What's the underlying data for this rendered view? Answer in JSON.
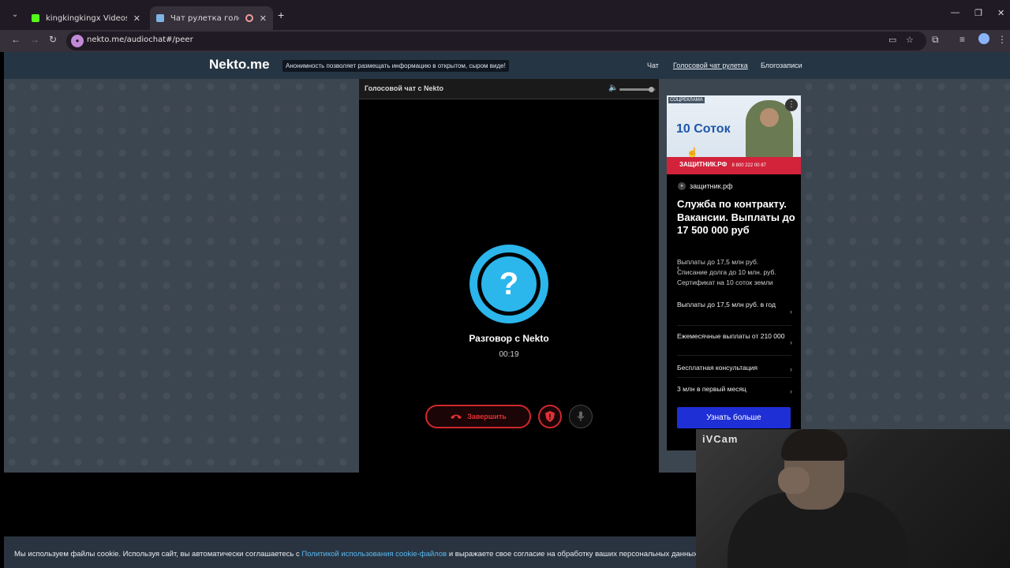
{
  "browser": {
    "tabs": [
      {
        "title": "kingkingkingx Videos - Watch Clips",
        "favicon_color": "#53fc18"
      },
      {
        "title": "Чат рулетка голосовая — Nekto.me",
        "favicon_color": "#7fb2e5"
      }
    ],
    "url": "nekto.me/audiochat#/peer"
  },
  "site": {
    "logo": "Nekto.me",
    "tagline": "Анонимность позволяет размещать информацию в открытом, сыром виде!",
    "nav": [
      {
        "label": "Чат"
      },
      {
        "label": "Голосовой чат рулетка"
      },
      {
        "label": "Блогозаписи"
      }
    ]
  },
  "chat": {
    "title": "Голосовой чат с Nekto",
    "volume": 0.9,
    "avatar_glyph": "?",
    "peer_name": "Разговор с Nekto",
    "timer": "00:19",
    "end_label": "Завершить",
    "accent": "#2bb6ec",
    "danger": "#d0282c"
  },
  "ad": {
    "label": "СОЦРЕКЛАМА",
    "banner_headline": "10 Соток",
    "banner_strip": "ЗАЩИТНИК.РФ",
    "banner_phone": "8 800 222 00 87",
    "site": "защитник.рф",
    "title": "Служба по контракту. Вакансии. Выплаты до 17 500 000 руб",
    "desc_lines": [
      "Выплаты до 17,5 млн руб.",
      "Списание долга до 10 млн. руб.",
      "Сертификат на 10 соток земли"
    ],
    "rows": [
      {
        "label": "Выплаты до 17,5 млн руб. в год"
      },
      {
        "label": "Ежемесячные выплаты от 210 000"
      },
      {
        "label": "Бесплатная консультация"
      },
      {
        "label": "3 млн в первый месяц"
      }
    ],
    "cta": "Узнать больше"
  },
  "cookie": {
    "before": "Мы используем файлы cookie. Используя сайт, вы автоматически соглашаетесь с ",
    "link": "Политикой использования cookie-файлов",
    "after": " и выражаете свое согласие на обработку ваших персональных данных с и"
  },
  "webcam": {
    "label": "iVCam"
  }
}
